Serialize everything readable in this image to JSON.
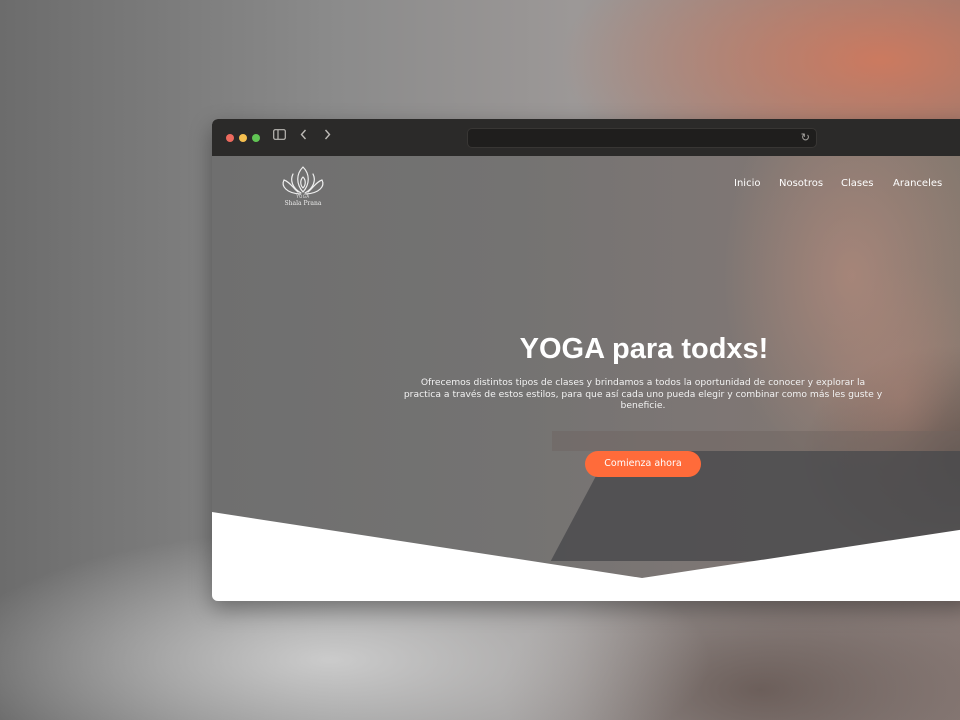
{
  "browser": {
    "traffic_lights": [
      "#ed6a5e",
      "#f5bf4f",
      "#61c554"
    ],
    "toolbar_icons": [
      "sidebar-icon",
      "back-icon",
      "forward-icon",
      "reload-icon"
    ],
    "reload_glyph": "↻",
    "back_glyph": "‹",
    "forward_glyph": "›",
    "sidebar_glyph": "▯"
  },
  "site": {
    "logo": {
      "small_text": "YOGA",
      "name": "Shala Prana"
    },
    "nav": [
      {
        "label": "Inicio"
      },
      {
        "label": "Nosotros"
      },
      {
        "label": "Clases"
      },
      {
        "label": "Aranceles"
      }
    ],
    "hero": {
      "title": "YOGA para todxs!",
      "text": "Ofrecemos distintos tipos de clases y brindamos a todos la oportunidad de conocer y explorar la practica a través de estos estilos, para que así cada uno pueda elegir y combinar como más les guste y beneficie.",
      "cta_label": "Comienza ahora"
    },
    "accent_color": "#ff6b3a"
  }
}
